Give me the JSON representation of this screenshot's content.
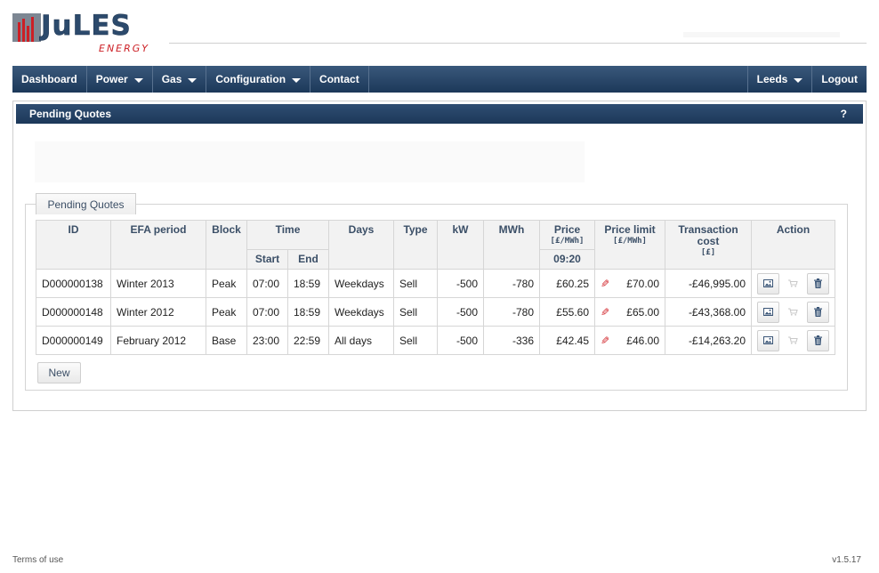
{
  "brand": {
    "name": "JuLES",
    "sub": "ENERGY",
    "accent": "#cc1f25",
    "primary": "#2c4a6c"
  },
  "nav": {
    "left": [
      {
        "label": "Dashboard",
        "dropdown": false
      },
      {
        "label": "Power",
        "dropdown": true
      },
      {
        "label": "Gas",
        "dropdown": true
      },
      {
        "label": "Configuration",
        "dropdown": true
      },
      {
        "label": "Contact",
        "dropdown": false
      }
    ],
    "right": [
      {
        "label": "Leeds",
        "dropdown": true
      },
      {
        "label": "Logout",
        "dropdown": false
      }
    ]
  },
  "panel": {
    "title": "Pending Quotes",
    "help": "?"
  },
  "group": {
    "tab_label": "Pending Quotes"
  },
  "table": {
    "headers": {
      "id": "ID",
      "efa": "EFA period",
      "block": "Block",
      "time": "Time",
      "start": "Start",
      "end": "End",
      "days": "Days",
      "type": "Type",
      "kw": "kW",
      "mwh": "MWh",
      "price": "Price",
      "price_unit": "[£/MWh]",
      "price_time": "09:20",
      "limit": "Price limit",
      "limit_unit": "[£/MWh]",
      "cost": "Transaction cost",
      "cost_unit": "[£]",
      "action": "Action"
    },
    "rows": [
      {
        "id": "D000000138",
        "efa": "Winter 2013",
        "block": "Peak",
        "start": "07:00",
        "end": "18:59",
        "days": "Weekdays",
        "type": "Sell",
        "kw": "-500",
        "mwh": "-780",
        "price": "£60.25",
        "limit": "£70.00",
        "cost": "-£46,995.00"
      },
      {
        "id": "D000000148",
        "efa": "Winter 2012",
        "block": "Peak",
        "start": "07:00",
        "end": "18:59",
        "days": "Weekdays",
        "type": "Sell",
        "kw": "-500",
        "mwh": "-780",
        "price": "£55.60",
        "limit": "£65.00",
        "cost": "-£43,368.00"
      },
      {
        "id": "D000000149",
        "efa": "February 2012",
        "block": "Base",
        "start": "23:00",
        "end": "22:59",
        "days": "All days",
        "type": "Sell",
        "kw": "-500",
        "mwh": "-336",
        "price": "£42.45",
        "limit": "£46.00",
        "cost": "-£14,263.20"
      }
    ]
  },
  "new_button": "New",
  "footer": {
    "terms": "Terms of use",
    "version": "v1.5.17"
  },
  "icons": {
    "edit": "pencil-icon",
    "view": "image-icon",
    "cart": "cart-icon",
    "delete": "trash-icon"
  }
}
